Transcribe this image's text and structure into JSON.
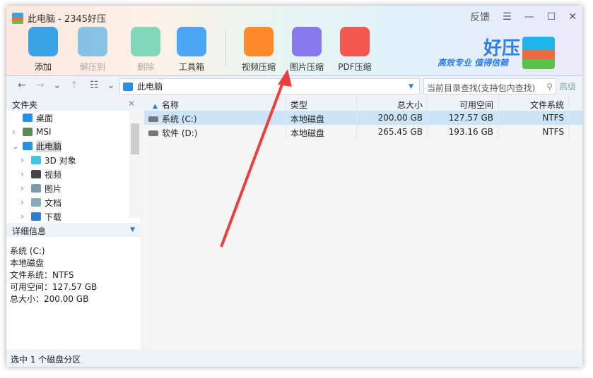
{
  "window": {
    "title": "此电脑 - 2345好压",
    "feedback": "反馈"
  },
  "toolbar": [
    {
      "label": "添加",
      "disabled": false,
      "color": "#3aa3e6"
    },
    {
      "label": "解压到",
      "disabled": true,
      "color": "#3aa3e6"
    },
    {
      "label": "删除",
      "disabled": true,
      "color": "#2ec79b"
    },
    {
      "label": "工具箱",
      "disabled": false,
      "color": "#4da6f5"
    },
    {
      "label": "视频压缩",
      "disabled": false,
      "color": "#ff8a2a"
    },
    {
      "label": "图片压缩",
      "disabled": false,
      "color": "#8a78f0"
    },
    {
      "label": "PDF压缩",
      "disabled": false,
      "color": "#f5584f"
    }
  ],
  "brand": {
    "name": "好压",
    "slogan": "高效专业  值得信赖"
  },
  "nav": {
    "address": "此电脑",
    "search_placeholder": "当前目录查找(支持包内查找)",
    "advanced": "高级"
  },
  "folders": {
    "title": "文件夹",
    "items": [
      {
        "label": "桌面",
        "indent": 0,
        "expander": "",
        "icon": "desktop-icon"
      },
      {
        "label": "MSI",
        "indent": 0,
        "expander": "›",
        "icon": "user-icon"
      },
      {
        "label": "此电脑",
        "indent": 0,
        "expander": "⌄",
        "icon": "computer-icon",
        "selected": true
      },
      {
        "label": "3D 对象",
        "indent": 1,
        "expander": "›",
        "icon": "cube-icon"
      },
      {
        "label": "视频",
        "indent": 1,
        "expander": "›",
        "icon": "video-icon"
      },
      {
        "label": "图片",
        "indent": 1,
        "expander": "›",
        "icon": "picture-icon"
      },
      {
        "label": "文档",
        "indent": 1,
        "expander": "›",
        "icon": "document-icon"
      },
      {
        "label": "下载",
        "indent": 1,
        "expander": "›",
        "icon": "download-icon"
      }
    ]
  },
  "details": {
    "title": "详细信息",
    "lines": [
      "系统 (C:)",
      "本地磁盘",
      "文件系统：NTFS",
      "可用空间：127.57 GB",
      "总大小：200.00 GB"
    ]
  },
  "table": {
    "columns": [
      "名称",
      "类型",
      "总大小",
      "可用空间",
      "文件系统"
    ],
    "rows": [
      {
        "name": "系统 (C:)",
        "type": "本地磁盘",
        "total": "200.00 GB",
        "free": "127.57 GB",
        "fs": "NTFS",
        "selected": true
      },
      {
        "name": "软件 (D:)",
        "type": "本地磁盘",
        "total": "265.45 GB",
        "free": "193.16 GB",
        "fs": "NTFS"
      }
    ]
  },
  "status": "选中 1 个磁盘分区",
  "annotation_color": "#e8403c"
}
